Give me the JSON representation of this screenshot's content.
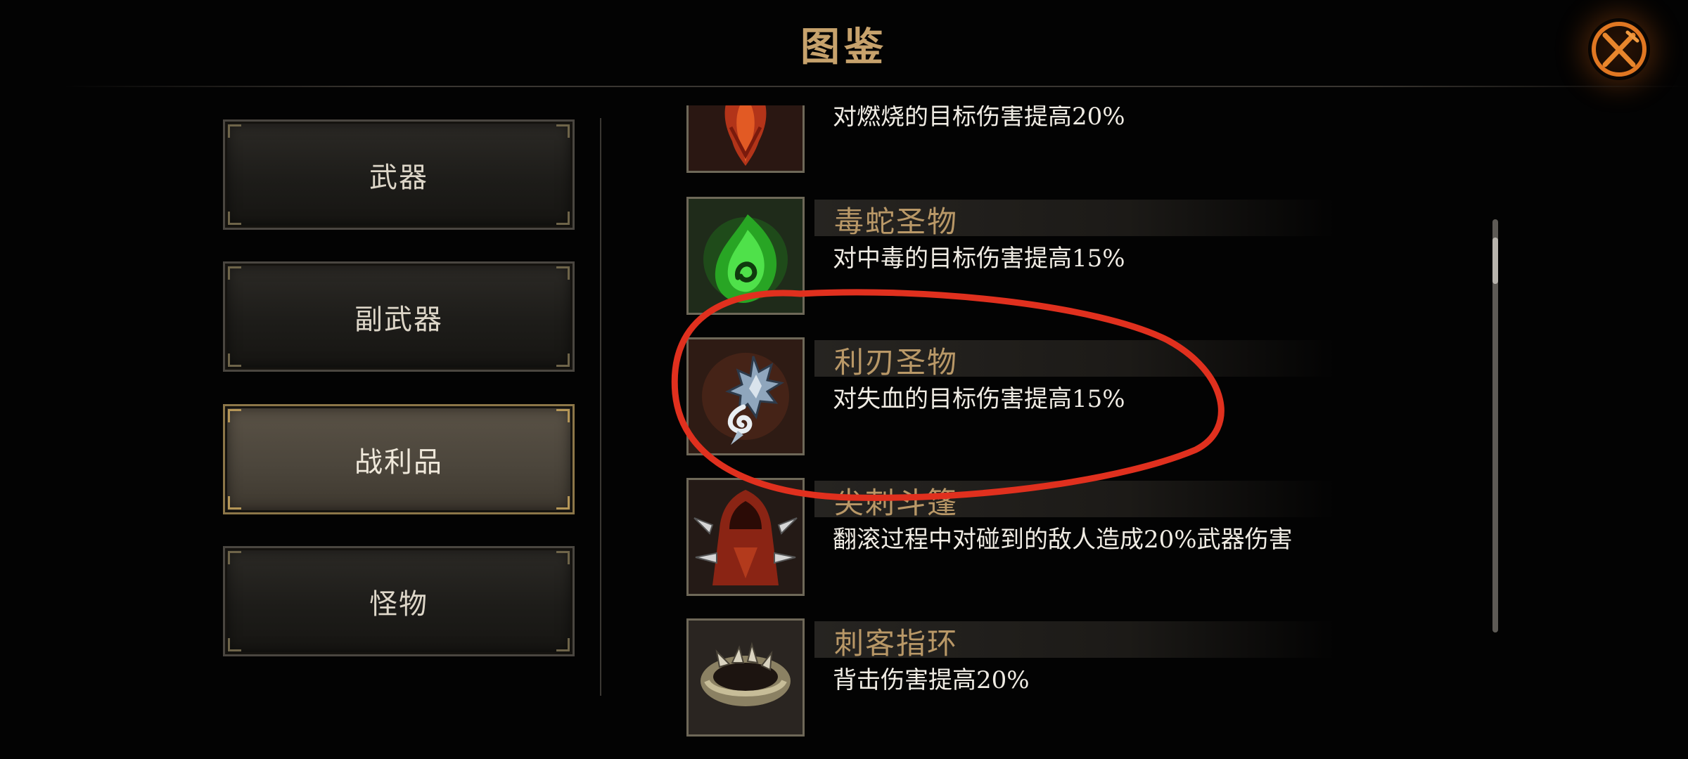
{
  "header": {
    "title": "图鉴",
    "close_icon": "close-crossed-blades-icon"
  },
  "categories": [
    {
      "label": "武器",
      "active": false
    },
    {
      "label": "副武器",
      "active": false
    },
    {
      "label": "战利品",
      "active": true
    },
    {
      "label": "怪物",
      "active": false
    }
  ],
  "items": [
    {
      "name": "",
      "desc": "对燃烧的目标伤害提高20%",
      "icon": "flame-relic-icon"
    },
    {
      "name": "毒蛇圣物",
      "desc": "对中毒的目标伤害提高15%",
      "icon": "viper-relic-icon"
    },
    {
      "name": "利刃圣物",
      "desc": "对失血的目标伤害提高15%",
      "icon": "blade-relic-icon"
    },
    {
      "name": "尖刺斗篷",
      "desc": "翻滚过程中对碰到的敌人造成20%武器伤害",
      "icon": "spiked-cloak-icon"
    },
    {
      "name": "刺客指环",
      "desc": "背击伤害提高20%",
      "icon": "assassin-ring-icon"
    }
  ],
  "colors": {
    "title": "#c7a26c",
    "item_name": "#b99867",
    "annotation": "#e0301e",
    "active_border": "#8c7648"
  },
  "scroll_position": 0.1
}
